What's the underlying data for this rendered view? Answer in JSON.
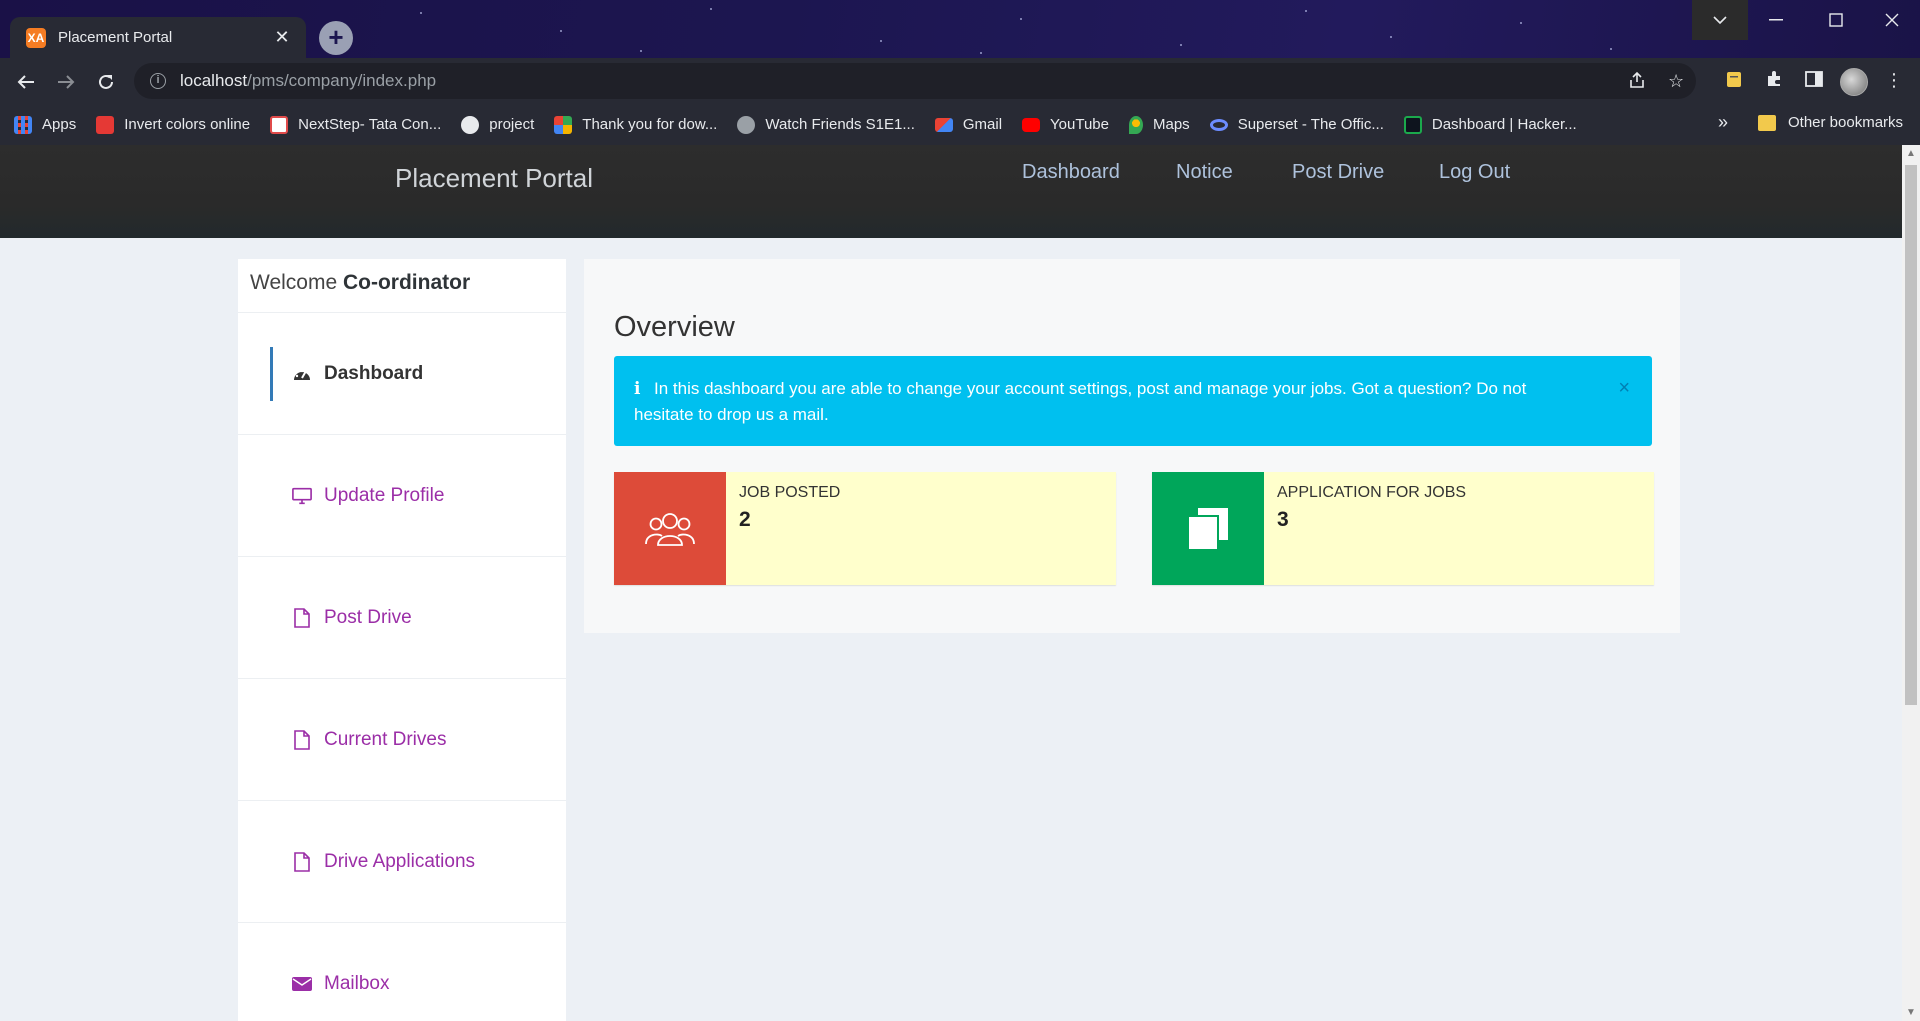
{
  "browser": {
    "tab_title": "Placement Portal",
    "tab_favicon": "XA",
    "url_host": "localhost",
    "url_path": "/pms/company/index.php",
    "new_tab": "+",
    "bookmarks": [
      {
        "label": "Apps",
        "icon": "apps-grid-icon",
        "color": "#4285f4"
      },
      {
        "label": "Invert colors online",
        "icon": "tree-icon",
        "color": "#e53935"
      },
      {
        "label": "NextStep- Tata Con...",
        "icon": "tcs-icon",
        "color": "#e04a4a"
      },
      {
        "label": "project",
        "icon": "github-icon",
        "color": "#e8eaed"
      },
      {
        "label": "Thank you for dow...",
        "icon": "windows-icon",
        "color": "#f4b400"
      },
      {
        "label": "Watch Friends S1E1...",
        "icon": "globe-icon",
        "color": "#9aa0a6"
      },
      {
        "label": "Gmail",
        "icon": "gmail-icon",
        "color": "#ea4335"
      },
      {
        "label": "YouTube",
        "icon": "youtube-icon",
        "color": "#ff0000"
      },
      {
        "label": "Maps",
        "icon": "maps-pin-icon",
        "color": "#34a853"
      },
      {
        "label": "Superset - The Offic...",
        "icon": "superset-icon",
        "color": "#6c8cff"
      },
      {
        "label": "Dashboard | Hacker...",
        "icon": "hackerrank-icon",
        "color": "#1ba94c"
      }
    ],
    "more_bookmarks": "»",
    "other_bookmarks": "Other bookmarks"
  },
  "nav": {
    "brand": "Placement Portal",
    "links": [
      "Dashboard",
      "Notice",
      "Post Drive",
      "Log Out"
    ]
  },
  "sidebar": {
    "welcome_prefix": "Welcome",
    "welcome_name": "Co-ordinator",
    "items": [
      {
        "label": "Dashboard",
        "icon": "dashboard-gauge-icon",
        "active": true
      },
      {
        "label": "Update Profile",
        "icon": "monitor-icon",
        "active": false
      },
      {
        "label": "Post Drive",
        "icon": "file-icon",
        "active": false
      },
      {
        "label": "Current Drives",
        "icon": "file-icon",
        "active": false
      },
      {
        "label": "Drive Applications",
        "icon": "file-icon",
        "active": false
      },
      {
        "label": "Mailbox",
        "icon": "envelope-icon",
        "active": false
      }
    ]
  },
  "main": {
    "title": "Overview",
    "alert_text": "In this dashboard you are able to change your account settings, post and manage your jobs. Got a question? Do not hesitate to drop us a mail.",
    "alert_close": "×",
    "stats": [
      {
        "label": "JOB POSTED",
        "value": "2",
        "color": "#dd4b39",
        "icon": "users-icon"
      },
      {
        "label": "APPLICATION FOR JOBS",
        "value": "3",
        "color": "#00a65a",
        "icon": "copy-icon"
      }
    ]
  },
  "colors": {
    "link_purple": "#9b2ea7",
    "nav_link": "#aec2dc",
    "alert_bg": "#00c0ef",
    "infobox_bg": "#ffffcc"
  }
}
